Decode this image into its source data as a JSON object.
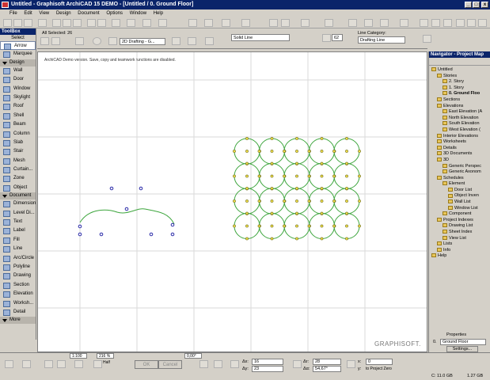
{
  "window": {
    "title": "Untitled - Graphisoft ArchiCAD 15 DEMO - [Untitled / 0. Ground Floor]",
    "controls": [
      "_",
      "□",
      "x"
    ]
  },
  "menu": [
    "File",
    "Edit",
    "View",
    "Design",
    "Document",
    "Options",
    "Window",
    "Help"
  ],
  "toolbox": {
    "title": "ToolBox",
    "select_label": "Select",
    "items_top": [
      "Arrow",
      "Marquee"
    ],
    "design_section": "Design",
    "design_items": [
      "Wall",
      "Door",
      "Window",
      "Skylight",
      "Roof",
      "Shell",
      "Beam",
      "Column",
      "Slab",
      "Stair",
      "Mesh",
      "Curtain...",
      "Zone",
      "Object"
    ],
    "document_section": "Document",
    "document_items": [
      "Dimension",
      "Level Di...",
      "Text",
      "Label",
      "Fill",
      "Line",
      "Arc/Circle",
      "Polyline",
      "Drawing",
      "Section",
      "Elevation",
      "Worksh...",
      "Detail"
    ],
    "more_section": "More"
  },
  "infobox": {
    "selected": "All Selected: 26",
    "view_mode": "2D Drafting - G...",
    "line_type": "Solid Line",
    "pen_number": "62",
    "line_category_label": "Line Category:",
    "line_category": "Drafting Line"
  },
  "canvas": {
    "demo_notice": "ArchiCAD Demo version. Save, copy and teamwork functions are disabled.",
    "watermark": "GRAPHISOFT."
  },
  "navigator": {
    "title": "Navigator - Project Map",
    "tree": [
      {
        "label": "Untitled",
        "indent": 0
      },
      {
        "label": "Stories",
        "indent": 1
      },
      {
        "label": "2. Story",
        "indent": 2
      },
      {
        "label": "1. Story",
        "indent": 2
      },
      {
        "label": "0. Ground Floo",
        "indent": 2,
        "bold": true
      },
      {
        "label": "Sections",
        "indent": 1
      },
      {
        "label": "Elevations",
        "indent": 1
      },
      {
        "label": "East Elevation (A",
        "indent": 2
      },
      {
        "label": "North Elevation",
        "indent": 2
      },
      {
        "label": "South Elevation",
        "indent": 2
      },
      {
        "label": "West Elevation (",
        "indent": 2
      },
      {
        "label": "Interior Elevations",
        "indent": 1
      },
      {
        "label": "Worksheets",
        "indent": 1
      },
      {
        "label": "Details",
        "indent": 1
      },
      {
        "label": "3D Documents",
        "indent": 1
      },
      {
        "label": "3D",
        "indent": 1
      },
      {
        "label": "Generic Perspec",
        "indent": 2
      },
      {
        "label": "Generic Axonom",
        "indent": 2
      },
      {
        "label": "Schedules",
        "indent": 1
      },
      {
        "label": "Element",
        "indent": 2
      },
      {
        "label": "Door List",
        "indent": 3
      },
      {
        "label": "Object Inven",
        "indent": 3
      },
      {
        "label": "Wall List",
        "indent": 3
      },
      {
        "label": "Window List",
        "indent": 3
      },
      {
        "label": "Component",
        "indent": 2
      },
      {
        "label": "Project Indexes",
        "indent": 1
      },
      {
        "label": "Drawing List",
        "indent": 2
      },
      {
        "label": "Sheet Index",
        "indent": 2
      },
      {
        "label": "View List",
        "indent": 2
      },
      {
        "label": "Lists",
        "indent": 1
      },
      {
        "label": "Info",
        "indent": 1
      },
      {
        "label": "Help",
        "indent": 0
      }
    ],
    "properties_label": "Properties",
    "current_story_num": "0.",
    "current_story": "Ground Floor",
    "settings_button": "Settings..."
  },
  "bottom": {
    "scale": "1:100",
    "zoom": "216 %",
    "angle": "0,00°",
    "half_label": "Half",
    "ok": "OK",
    "cancel": "Cancel",
    "dx_label": "Δx:",
    "dx": "16",
    "dy_label": "Δy:",
    "dy": "23",
    "dr_label": "Δr:",
    "dr": "28",
    "da_label": "Δα:",
    "da": "54,67°",
    "x_label": "x:",
    "x": "0",
    "y_label": "y:",
    "to_project_zero": "to Project Zero",
    "disk_c": "C: 11.0 GB",
    "disk_free": "1.27 GB"
  }
}
